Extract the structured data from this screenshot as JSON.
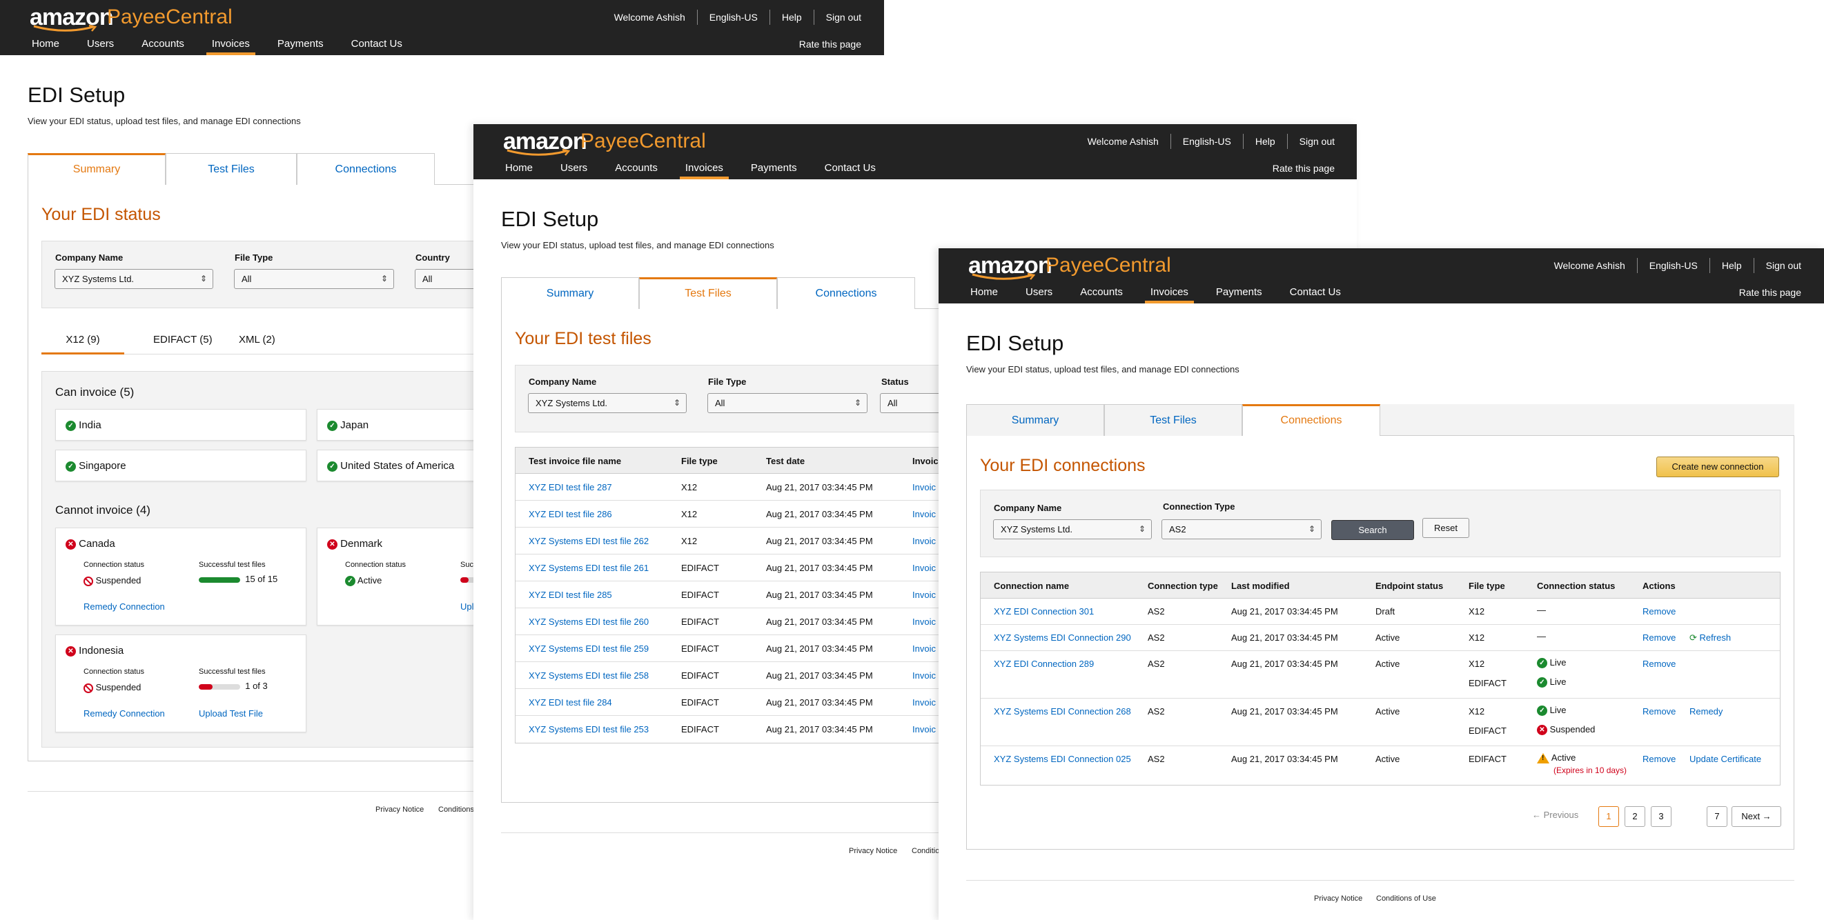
{
  "header": {
    "logo_amazon": "amazon",
    "logo_product": "PayeeCentral",
    "welcome": "Welcome Ashish",
    "lang": "English-US",
    "help": "Help",
    "signout": "Sign out",
    "rate": "Rate this page",
    "nav": [
      "Home",
      "Users",
      "Accounts",
      "Invoices",
      "Payments",
      "Contact Us"
    ],
    "active_nav": "Invoices"
  },
  "page": {
    "title": "EDI Setup",
    "subtitle": "View your EDI status, upload test files, and manage EDI connections"
  },
  "tabs": [
    "Summary",
    "Test Files",
    "Connections"
  ],
  "footer": {
    "privacy": "Privacy Notice",
    "conditions_short": "Conditions",
    "conditions": "Conditions of Use"
  },
  "summary": {
    "heading": "Your EDI status",
    "filters": {
      "company_label": "Company Name",
      "company_value": "XYZ Systems Ltd.",
      "filetype_label": "File Type",
      "filetype_value": "All",
      "country_label": "Country",
      "country_value": "All"
    },
    "subtabs": [
      "X12 (9)",
      "EDIFACT (5)",
      "XML (2)"
    ],
    "can_heading": "Can invoice (5)",
    "can_countries": [
      "India",
      "Japan",
      "Singapore",
      "United States of America"
    ],
    "cannot_heading": "Cannot invoice (4)",
    "cannot": [
      {
        "country": "Canada",
        "conn_label": "Connection status",
        "conn_value": "Suspended",
        "files_label": "Successful test files",
        "files_value": "15 of 15",
        "files_pct": 100,
        "action1": "Remedy Connection",
        "action2": ""
      },
      {
        "country": "Denmark",
        "conn_label": "Connection status",
        "conn_value": "Active",
        "files_label": "Suc",
        "files_value": "",
        "files_pct": 20,
        "action1": "",
        "action2": "Upl"
      },
      {
        "country": "Indonesia",
        "conn_label": "Connection status",
        "conn_value": "Suspended",
        "files_label": "Successful test files",
        "files_value": "1 of 3",
        "files_pct": 33,
        "action1": "Remedy Connection",
        "action2": "Upload Test File"
      }
    ]
  },
  "testfiles": {
    "heading": "Your EDI test files",
    "filters": {
      "company_label": "Company Name",
      "company_value": "XYZ Systems Ltd.",
      "filetype_label": "File Type",
      "filetype_value": "All",
      "status_label": "Status",
      "status_value": "All"
    },
    "columns": [
      "Test invoice file name",
      "File type",
      "Test date",
      "Invoic"
    ],
    "rows": [
      {
        "name": "XYZ EDI test file 287",
        "type": "X12",
        "date": "Aug 21, 2017  03:34:45 PM",
        "inv": "Invoic"
      },
      {
        "name": "XYZ EDI test file 286",
        "type": "X12",
        "date": "Aug 21, 2017  03:34:45 PM",
        "inv": "Invoic"
      },
      {
        "name": "XYZ Systems EDI test file 262",
        "type": "X12",
        "date": "Aug 21, 2017  03:34:45 PM",
        "inv": "Invoic"
      },
      {
        "name": "XYZ Systems EDI test file 261",
        "type": "EDIFACT",
        "date": "Aug 21, 2017  03:34:45 PM",
        "inv": "Invoic"
      },
      {
        "name": "XYZ EDI test file 285",
        "type": "EDIFACT",
        "date": "Aug 21, 2017  03:34:45 PM",
        "inv": "Invoic"
      },
      {
        "name": "XYZ Systems EDI test file 260",
        "type": "EDIFACT",
        "date": "Aug 21, 2017  03:34:45 PM",
        "inv": "Invoic"
      },
      {
        "name": "XYZ Systems EDI test file 259",
        "type": "EDIFACT",
        "date": "Aug 21, 2017  03:34:45 PM",
        "inv": "Invoic"
      },
      {
        "name": "XYZ Systems EDI test file 258",
        "type": "EDIFACT",
        "date": "Aug 21, 2017  03:34:45 PM",
        "inv": "Invoic"
      },
      {
        "name": "XYZ EDI test file 284",
        "type": "EDIFACT",
        "date": "Aug 21, 2017  03:34:45 PM",
        "inv": "Invoic"
      },
      {
        "name": "XYZ Systems EDI test file 253",
        "type": "EDIFACT",
        "date": "Aug 21, 2017  03:34:45 PM",
        "inv": "Invoic"
      }
    ]
  },
  "connections": {
    "heading": "Your EDI connections",
    "create_button": "Create new connection",
    "filters": {
      "company_label": "Company Name",
      "company_value": "XYZ Systems Ltd.",
      "type_label": "Connection Type",
      "type_value": "AS2",
      "search": "Search",
      "reset": "Reset"
    },
    "columns": [
      "Connection name",
      "Connection type",
      "Last modified",
      "Endpoint status",
      "File type",
      "Connection status",
      "Actions"
    ],
    "rows": [
      {
        "name": "XYZ EDI Connection 301",
        "type": "AS2",
        "modified": "Aug 21, 2017  03:34:45 PM",
        "endpoint": "Draft",
        "files": [
          {
            "ft": "X12",
            "status": "—",
            "icon": "none"
          }
        ],
        "actions": [
          "Remove"
        ]
      },
      {
        "name": "XYZ Systems EDI Connection 290",
        "type": "AS2",
        "modified": "Aug 21, 2017  03:34:45 PM",
        "endpoint": "Active",
        "files": [
          {
            "ft": "X12",
            "status": "—",
            "icon": "none"
          }
        ],
        "actions": [
          "Remove",
          "Refresh"
        ]
      },
      {
        "name": "XYZ EDI Connection 289",
        "type": "AS2",
        "modified": "Aug 21, 2017  03:34:45 PM",
        "endpoint": "Active",
        "files": [
          {
            "ft": "X12",
            "status": "Live",
            "icon": "ok"
          },
          {
            "ft": "EDIFACT",
            "status": "Live",
            "icon": "ok"
          }
        ],
        "actions": [
          "Remove"
        ]
      },
      {
        "name": "XYZ Systems EDI Connection 268",
        "type": "AS2",
        "modified": "Aug 21, 2017  03:34:45 PM",
        "endpoint": "Active",
        "files": [
          {
            "ft": "X12",
            "status": "Live",
            "icon": "ok"
          },
          {
            "ft": "EDIFACT",
            "status": "Suspended",
            "icon": "err"
          }
        ],
        "actions": [
          "Remove",
          "Remedy"
        ]
      },
      {
        "name": "XYZ Systems EDI Connection 025",
        "type": "AS2",
        "modified": "Aug 21, 2017  03:34:45 PM",
        "endpoint": "Active",
        "files": [
          {
            "ft": "EDIFACT",
            "status": "Active",
            "icon": "warn",
            "note": "(Expires in 10 days)"
          }
        ],
        "actions": [
          "Remove",
          "Update Certificate"
        ]
      }
    ],
    "pagination": {
      "prev": "← Previous",
      "pages": [
        "1",
        "2",
        "3"
      ],
      "last": "7",
      "next": "Next →",
      "current": "1"
    }
  },
  "colors": {
    "header_bg": "#232323",
    "accent": "#e47911",
    "link": "#0066c0",
    "ok": "#1b8a2f",
    "error": "#d0021b"
  }
}
